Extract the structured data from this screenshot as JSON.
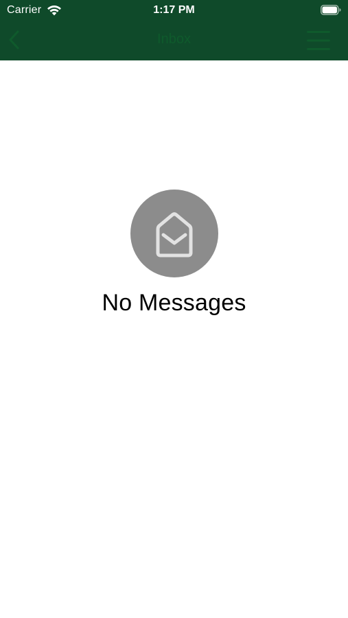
{
  "status_bar": {
    "carrier": "Carrier",
    "time": "1:17 PM",
    "wifi_icon": "wifi-icon",
    "battery_icon": "battery-full-icon"
  },
  "nav_bar": {
    "title": "Inbox",
    "back_icon": "chevron-left-icon",
    "menu_icon": "hamburger-menu-icon",
    "background_color": "#0f4a2a",
    "tint_color": "#0f5a2c"
  },
  "empty_state": {
    "icon": "open-envelope-icon",
    "message": "No Messages",
    "icon_bg_color": "#8c8c8c"
  }
}
